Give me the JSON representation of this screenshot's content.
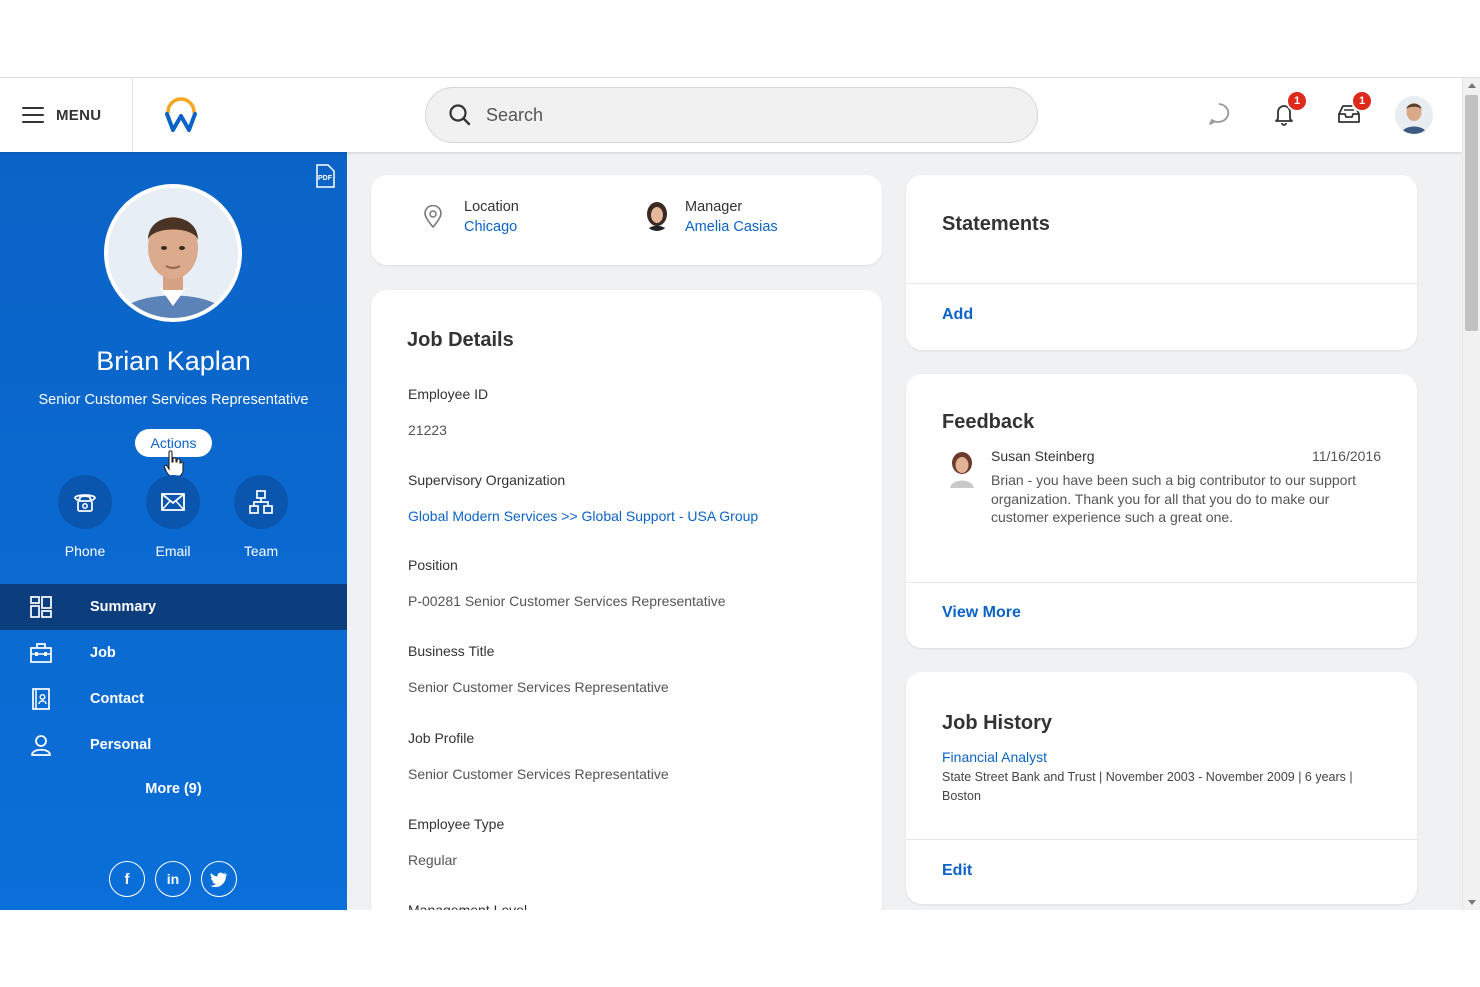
{
  "header": {
    "menu_label": "MENU",
    "search_placeholder": "Search",
    "notifications_badge": "1",
    "inbox_badge": "1"
  },
  "profile": {
    "name": "Brian Kaplan",
    "title": "Senior Customer Services Representative",
    "actions_label": "Actions",
    "quick_actions": [
      {
        "label": "Phone",
        "icon": "phone-icon"
      },
      {
        "label": "Email",
        "icon": "email-icon"
      },
      {
        "label": "Team",
        "icon": "team-icon"
      }
    ]
  },
  "sidebar": {
    "items": [
      {
        "label": "Summary",
        "icon": "summary-icon",
        "active": true
      },
      {
        "label": "Job",
        "icon": "briefcase-icon"
      },
      {
        "label": "Contact",
        "icon": "contact-card-icon"
      },
      {
        "label": "Personal",
        "icon": "person-icon"
      }
    ],
    "more_label": "More (9)",
    "social": [
      {
        "label": "f",
        "icon": "facebook-icon"
      },
      {
        "label": "in",
        "icon": "linkedin-icon"
      },
      {
        "label": "twitter",
        "icon": "twitter-icon"
      }
    ]
  },
  "location_card": {
    "location_label": "Location",
    "location_value": "Chicago",
    "manager_label": "Manager",
    "manager_value": "Amelia Casias"
  },
  "job_details": {
    "title": "Job Details",
    "fields": [
      {
        "label": "Employee ID",
        "value": "21223"
      },
      {
        "label": "Supervisory Organization",
        "value": "Global Modern Services >> Global Support - USA Group",
        "link": true
      },
      {
        "label": "Position",
        "value": "P-00281 Senior Customer Services Representative"
      },
      {
        "label": "Business Title",
        "value": "Senior Customer Services Representative"
      },
      {
        "label": "Job Profile",
        "value": "Senior Customer Services Representative"
      },
      {
        "label": "Employee Type",
        "value": "Regular"
      },
      {
        "label": "Management Level",
        "value": ""
      }
    ]
  },
  "statements": {
    "title": "Statements",
    "add_label": "Add"
  },
  "feedback": {
    "title": "Feedback",
    "author": "Susan Steinberg",
    "date": "11/16/2016",
    "text_lines": [
      "Brian - you have been such a big contributor to our support",
      "organization. Thank you for all that you do to make our",
      "customer experience such a great one."
    ],
    "view_more_label": "View More"
  },
  "job_history": {
    "title": "Job History",
    "role": "Financial Analyst",
    "detail_lines": [
      "State Street Bank and Trust | November 2003 - November 2009 | 6 years |",
      "Boston"
    ],
    "edit_label": "Edit"
  },
  "colors": {
    "brand_blue": "#0b63c7",
    "nav_active": "#0c3e7e",
    "badge_red": "#de2a1b"
  }
}
